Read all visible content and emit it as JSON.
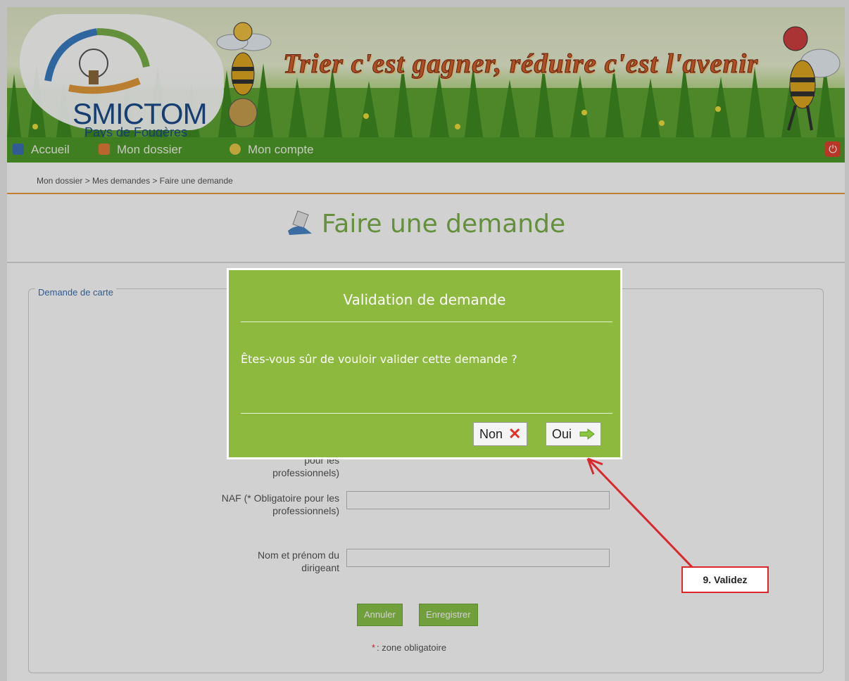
{
  "header": {
    "logo_title": "SMICTOM",
    "logo_subtitle": "Pays de Fougères",
    "slogan": "Trier c'est gagner, réduire c'est l'avenir"
  },
  "nav": {
    "items": [
      {
        "label": "Accueil",
        "icon": "home-icon"
      },
      {
        "label": "Mon dossier",
        "icon": "folder-icon"
      },
      {
        "label": "Mon compte",
        "icon": "user-icon"
      }
    ],
    "logout_icon": "power-icon"
  },
  "breadcrumb": "Mon dossier > Mes demandes > Faire une demande",
  "page_title": "Faire une demande",
  "form": {
    "legend": "Demande de carte",
    "partial_label_1": "pour les",
    "partial_label_2": "professionnels)",
    "naf_label": "NAF (* Obligatoire pour les professionnels)",
    "dirigeant_label": "Nom et prénom du dirigeant",
    "cancel_label": "Annuler",
    "save_label": "Enregistrer",
    "required_note": ": zone obligatoire",
    "required_star": "*"
  },
  "dialog": {
    "title": "Validation de demande",
    "message": "Êtes-vous sûr de vouloir valider cette demande ?",
    "no_label": "Non",
    "yes_label": "Oui"
  },
  "callout": "9. Validez",
  "colors": {
    "nav_green": "#4f9a2a",
    "dialog_green": "#8dba3e",
    "title_green": "#7ab04a",
    "accent_orange": "#ef9a3c",
    "callout_red": "#d9282c"
  }
}
